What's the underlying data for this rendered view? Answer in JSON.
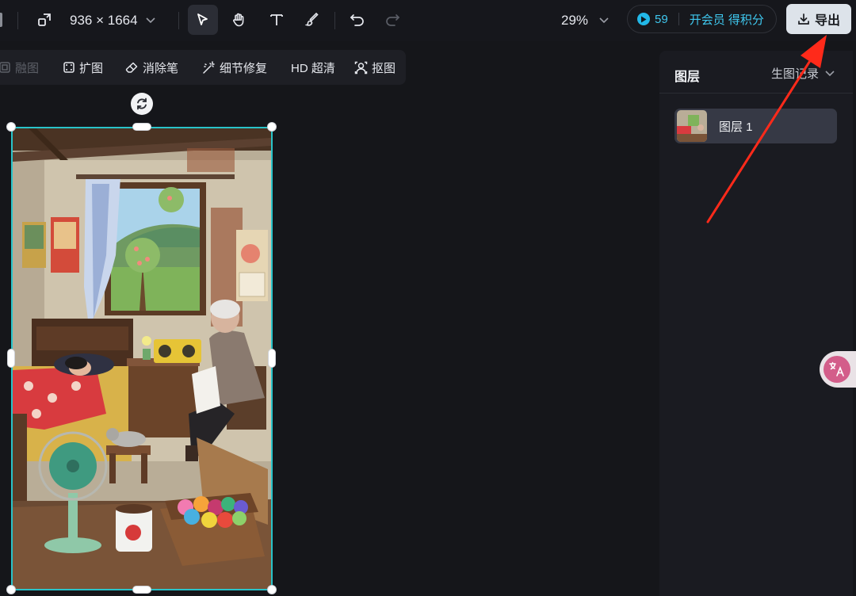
{
  "toolbar": {
    "canvas_size": "936 × 1664",
    "zoom": "29%",
    "member": {
      "points": "59",
      "label": "开会员 得积分"
    },
    "export_label": "导出"
  },
  "edit_tools": [
    {
      "label": "融图",
      "icon": "blend-icon",
      "enabled": false
    },
    {
      "label": "扩图",
      "icon": "expand-icon",
      "enabled": true
    },
    {
      "label": "消除笔",
      "icon": "eraser-icon",
      "enabled": true
    },
    {
      "label": "细节修复",
      "icon": "magic-wand-icon",
      "enabled": true
    },
    {
      "label": "HD 超清",
      "icon": "hd-icon",
      "enabled": true
    },
    {
      "label": "抠图",
      "icon": "cutout-icon",
      "enabled": true
    }
  ],
  "layers_panel": {
    "title": "图层",
    "history_dropdown": "生图记录",
    "layers": [
      {
        "name": "图层 1"
      }
    ]
  },
  "colors": {
    "background": "#15161a",
    "selection": "#29c3c9",
    "accent_cyan": "#3fc8ef",
    "annotation_arrow": "#ff2a1a"
  }
}
